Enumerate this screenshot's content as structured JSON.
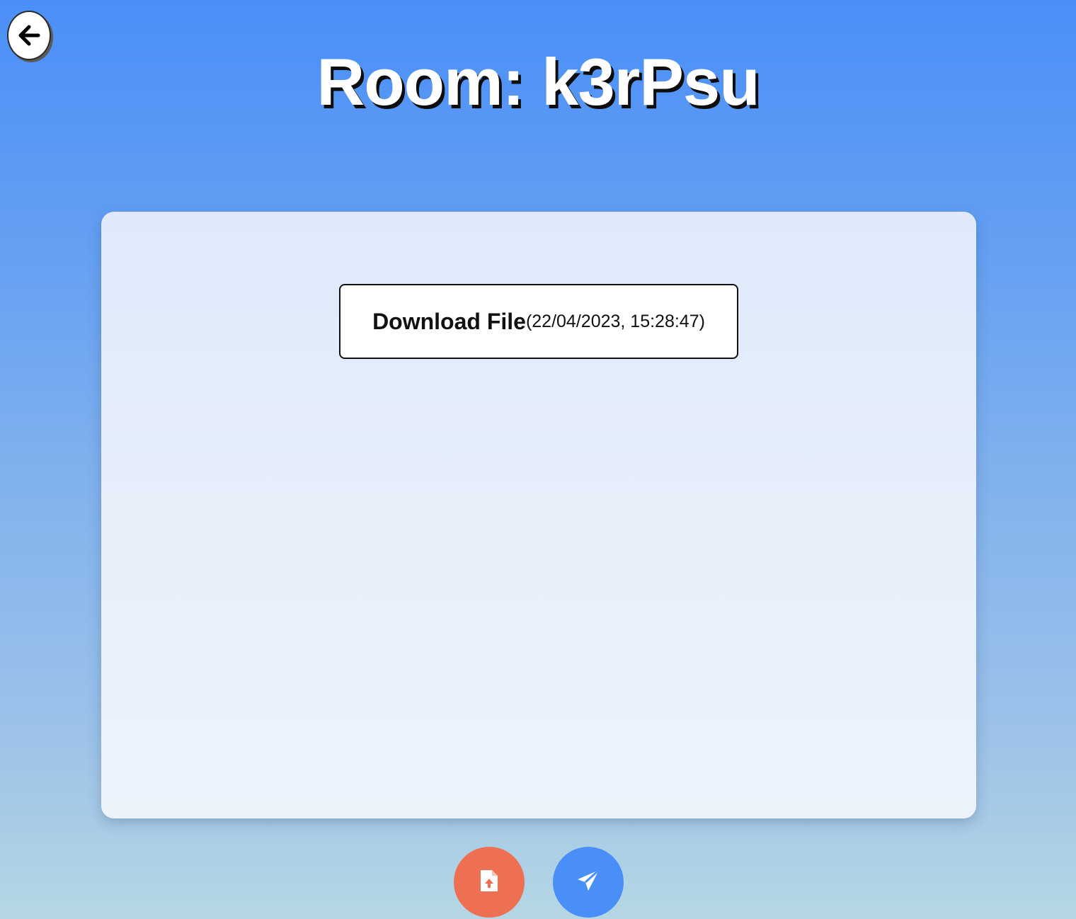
{
  "colors": {
    "gradient_top": "#4a8ff8",
    "gradient_bottom": "#b5d7e4",
    "panel": "#e5eefb",
    "upload_accent": "#ee7052",
    "send_accent": "#4a8ff8"
  },
  "header": {
    "back_icon": "arrow-left-icon",
    "title": "Room: k3rPsu"
  },
  "messages": [
    {
      "label": "Download File",
      "timestamp": "(22/04/2023, 15:28:47)"
    }
  ],
  "actions": {
    "upload_icon": "file-upload-icon",
    "send_icon": "paper-plane-icon"
  }
}
